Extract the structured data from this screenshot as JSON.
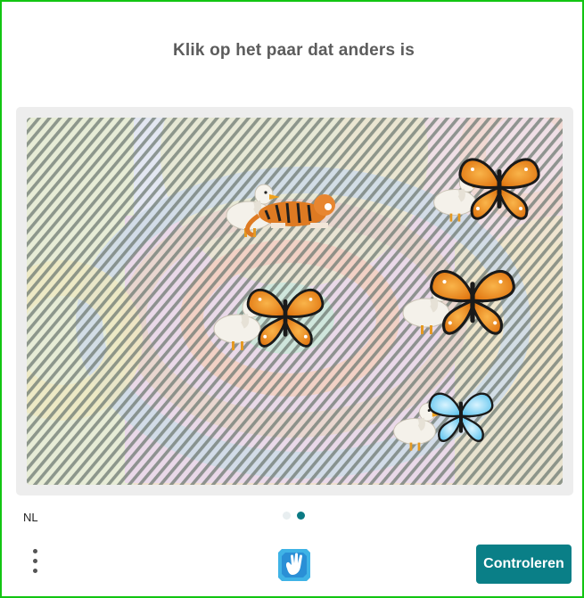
{
  "prompt": "Klik op het paar dat anders is",
  "language": "NL",
  "submit_label": "Controleren",
  "pagination": {
    "total": 2,
    "current": 2
  },
  "challenge": {
    "background": "striped-pastel-pattern",
    "pairs": [
      {
        "id": "pair-1",
        "animals": [
          "duck",
          "tiger"
        ]
      },
      {
        "id": "pair-2",
        "animals": [
          "duck",
          "butterfly"
        ]
      },
      {
        "id": "pair-3",
        "animals": [
          "duck",
          "butterfly"
        ]
      },
      {
        "id": "pair-4",
        "animals": [
          "duck",
          "butterfly"
        ]
      },
      {
        "id": "pair-5",
        "animals": [
          "duck",
          "butterfly"
        ]
      }
    ]
  },
  "colors": {
    "accent": "#0a7f87",
    "frame_border": "#12c512",
    "title_text": "#5c5c5c",
    "active_dot": "#0b7a84"
  },
  "icons": {
    "menu": "vertical-dots-icon",
    "logo": "hand-shield-logo-icon"
  }
}
